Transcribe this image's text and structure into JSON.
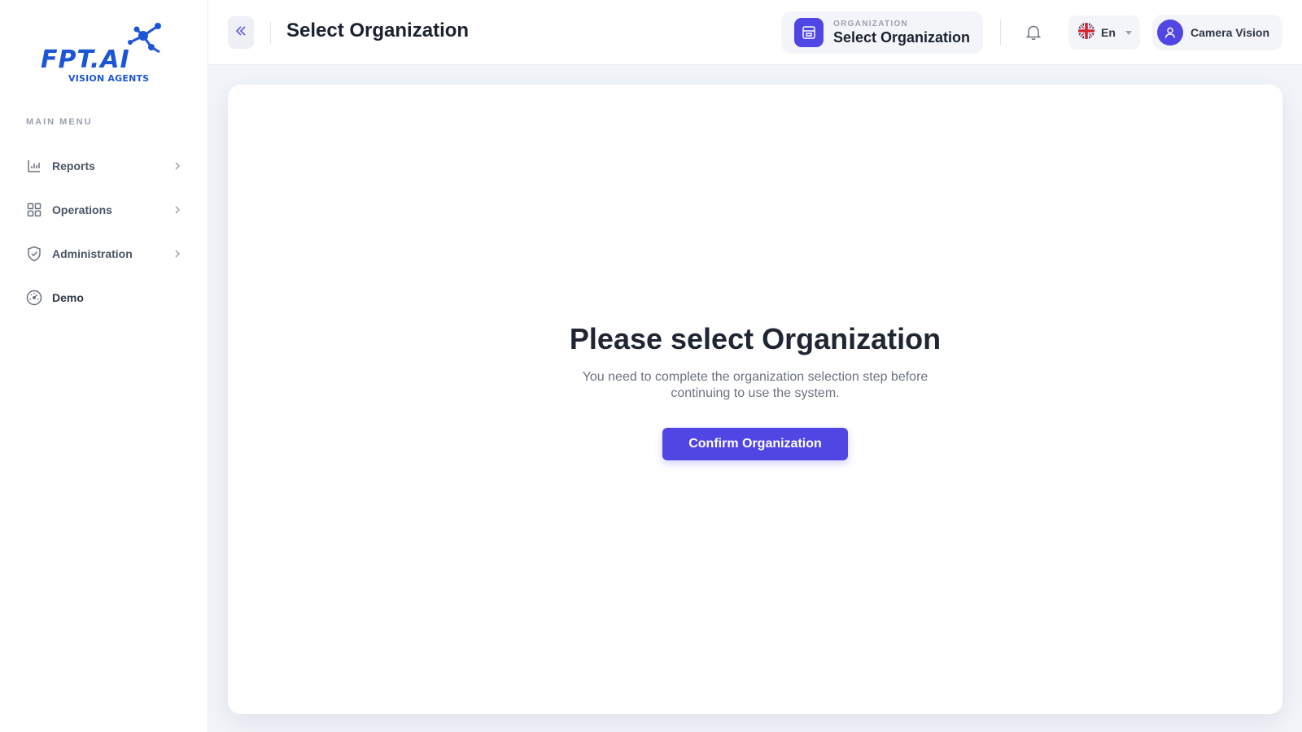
{
  "sidebar": {
    "logo_text": "FPT.AI",
    "logo_subtitle": "VISION AGENTS",
    "menu_heading": "MAIN MENU",
    "items": [
      {
        "label": "Reports",
        "icon": "bar-chart-icon",
        "has_submenu": true
      },
      {
        "label": "Operations",
        "icon": "grid-icon",
        "has_submenu": true
      },
      {
        "label": "Administration",
        "icon": "shield-check-icon",
        "has_submenu": true
      },
      {
        "label": "Demo",
        "icon": "gauge-icon",
        "has_submenu": false
      }
    ]
  },
  "header": {
    "title": "Select Organization",
    "organization": {
      "caption": "ORGANIZATION",
      "value": "Select Organization",
      "icon": "store-icon"
    },
    "language": {
      "label": "En",
      "flag": "uk-flag-icon"
    },
    "user": {
      "name": "Camera Vision",
      "icon": "user-icon"
    }
  },
  "main": {
    "title": "Please select Organization",
    "description": "You need to complete the organization selection step before continuing to use the system.",
    "confirm_label": "Confirm Organization"
  },
  "colors": {
    "accent": "#5046e4",
    "brand_blue": "#1b56d6",
    "background": "#f1f4f9"
  }
}
